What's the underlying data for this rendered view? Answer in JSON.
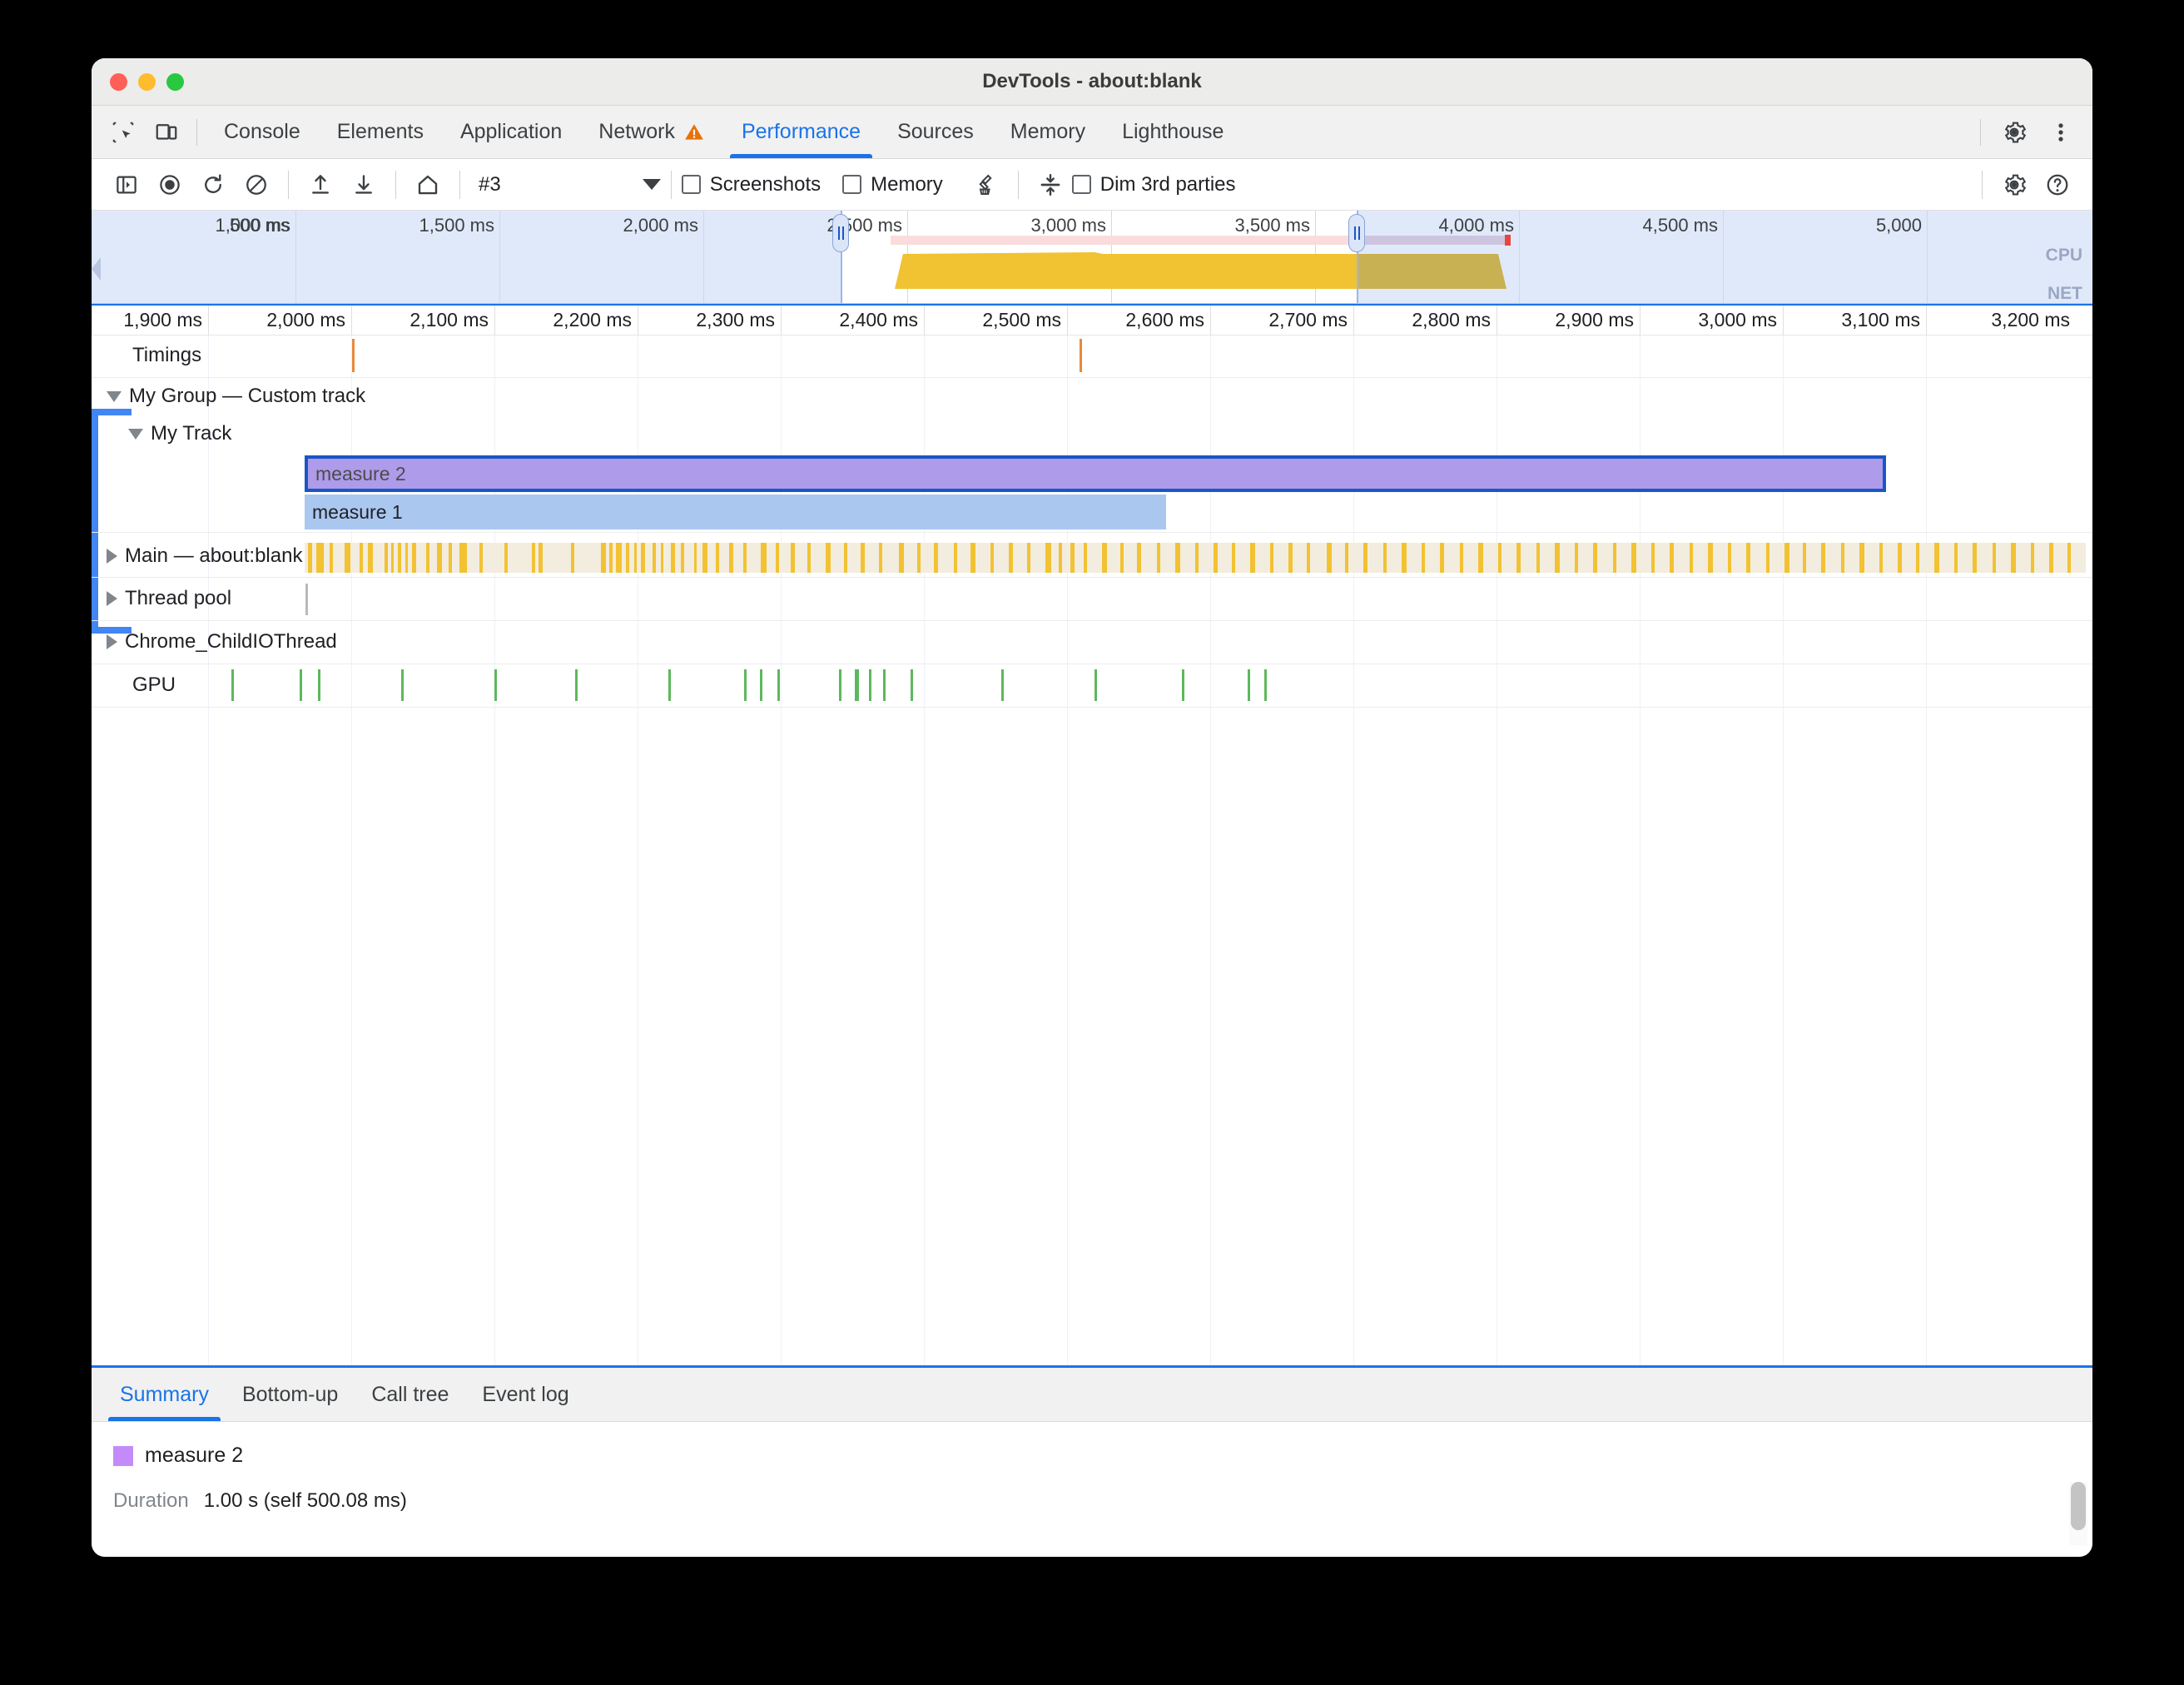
{
  "window": {
    "title": "DevTools - about:blank"
  },
  "tabbar": {
    "left_icons": [
      {
        "name": "inspect-element-icon"
      },
      {
        "name": "device-toolbar-icon"
      }
    ],
    "tabs": [
      {
        "label": "Console",
        "active": false,
        "warning": false
      },
      {
        "label": "Elements",
        "active": false,
        "warning": false
      },
      {
        "label": "Application",
        "active": false,
        "warning": false
      },
      {
        "label": "Network",
        "active": false,
        "warning": true
      },
      {
        "label": "Performance",
        "active": true,
        "warning": false
      },
      {
        "label": "Sources",
        "active": false,
        "warning": false
      },
      {
        "label": "Memory",
        "active": false,
        "warning": false
      },
      {
        "label": "Lighthouse",
        "active": false,
        "warning": false
      }
    ],
    "right_icons": [
      {
        "name": "settings-gear-icon"
      },
      {
        "name": "more-options-kebab-icon"
      }
    ]
  },
  "perf_toolbar": {
    "icons": [
      {
        "name": "toggle-sidebar-icon"
      },
      {
        "name": "record-icon"
      },
      {
        "name": "reload-and-record-icon"
      },
      {
        "name": "clear-icon"
      },
      {
        "name": "load-profile-icon"
      },
      {
        "name": "save-profile-icon"
      },
      {
        "name": "home-icon"
      }
    ],
    "recording_label": "#3",
    "dropdown_icon": "chevron-down-icon",
    "checkboxes": [
      {
        "label": "Screenshots",
        "checked": false
      },
      {
        "label": "Memory",
        "checked": false
      }
    ],
    "garbage_icon": "collect-garbage-brush-icon",
    "expand_icon": "collapse-expand-icon",
    "dim_checkbox": {
      "label": "Dim 3rd parties",
      "checked": false
    },
    "right_icons": [
      {
        "name": "capture-settings-gear-icon"
      },
      {
        "name": "help-question-icon"
      }
    ]
  },
  "overview": {
    "ticks": [
      "500 ms",
      "1,000 ms",
      "1,500 ms",
      "2,000 ms",
      "2,500 ms",
      "3,000 ms",
      "3,500 ms",
      "4,000 ms",
      "4,500 ms",
      "5,000"
    ],
    "cpu_label": "CPU",
    "net_label": "NET",
    "selection_start_ms": 2000,
    "selection_end_ms": 3400,
    "total_ms": 5000
  },
  "flame": {
    "ticks": [
      "1,900 ms",
      "2,000 ms",
      "2,100 ms",
      "2,200 ms",
      "2,300 ms",
      "2,400 ms",
      "2,500 ms",
      "2,600 ms",
      "2,700 ms",
      "2,800 ms",
      "2,900 ms",
      "3,000 ms",
      "3,100 ms",
      "3,200 ms"
    ],
    "tracks": [
      {
        "name": "Timings",
        "label": "Timings",
        "expander": "none"
      },
      {
        "name": "group-header",
        "label": "My Group — Custom track",
        "expander": "down"
      },
      {
        "name": "custom-track",
        "label": "My Track",
        "expander": "down"
      },
      {
        "name": "main-thread",
        "label": "Main — about:blank",
        "expander": "right"
      },
      {
        "name": "thread-pool",
        "label": "Thread pool",
        "expander": "right"
      },
      {
        "name": "child-io-thread",
        "label": "Chrome_ChildIOThread",
        "expander": "right"
      },
      {
        "name": "gpu",
        "label": "GPU",
        "expander": "none"
      }
    ],
    "events": [
      {
        "label": "measure 2",
        "selected": true,
        "color": "#ae9bea"
      },
      {
        "label": "measure 1",
        "selected": false,
        "color": "#aac7f0"
      }
    ]
  },
  "drawer": {
    "tabs": [
      {
        "label": "Summary",
        "active": true
      },
      {
        "label": "Bottom-up",
        "active": false
      },
      {
        "label": "Call tree",
        "active": false
      },
      {
        "label": "Event log",
        "active": false
      }
    ],
    "summary": {
      "event_name": "measure 2",
      "swatch_color": "#c58af9",
      "duration_key": "Duration",
      "duration_value": "1.00 s (self 500.08 ms)"
    }
  },
  "colors": {
    "accent": "#1a73e8",
    "warning": "#e8710a",
    "cpu_yellow": "#f1c232",
    "gpu_green": "#5cb85c",
    "main_band": "#f3eddf"
  }
}
